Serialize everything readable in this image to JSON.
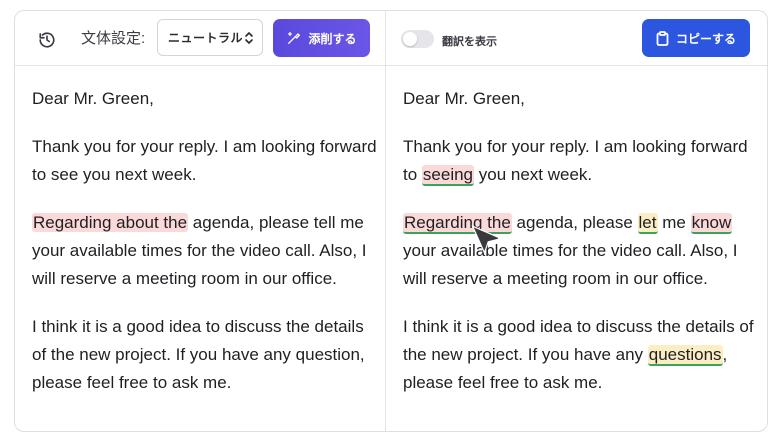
{
  "toolbar": {
    "history_icon": "history-icon",
    "style_label": "文体設定:",
    "style_value": "ニュートラル",
    "proofread_label": "添削する",
    "translate_toggle_label": "翻訳を表示",
    "copy_label": "コピーする"
  },
  "left": {
    "p1": "Dear Mr. Green,",
    "p2": "Thank you for your reply. I am looking forward to see you next week.",
    "p3_hl": "Regarding about the",
    "p3_rest": " agenda, please tell me your available times for the video call. Also, I will reserve a meeting room in our office.",
    "p4": "I think it is a good idea to discuss the details of the new project. If you have any question, please feel free to ask me."
  },
  "right": {
    "p1": "Dear Mr. Green,",
    "p2_a": "Thank you for your reply. I am looking forward to ",
    "p2_fix": "seeing",
    "p2_b": " you next week.",
    "p3_fix1": "Regarding the",
    "p3_a": " agenda, please ",
    "p3_fix2": "let",
    "p3_b": " me ",
    "p3_fix3": "know",
    "p3_c": " your available times for the video call. Also, I will reserve a meeting room in our office.",
    "p4_a": "I think it is a good idea to discuss the details of the new project. If you have any ",
    "p4_fix": "questions",
    "p4_b": ", please feel free to ask me."
  },
  "colors": {
    "proofread_button": "#5a49dd",
    "copy_button": "#2d56e0",
    "highlight_red": "#fbd9d9",
    "highlight_yellow": "#fbeec2",
    "underline_green": "#3aa655"
  }
}
